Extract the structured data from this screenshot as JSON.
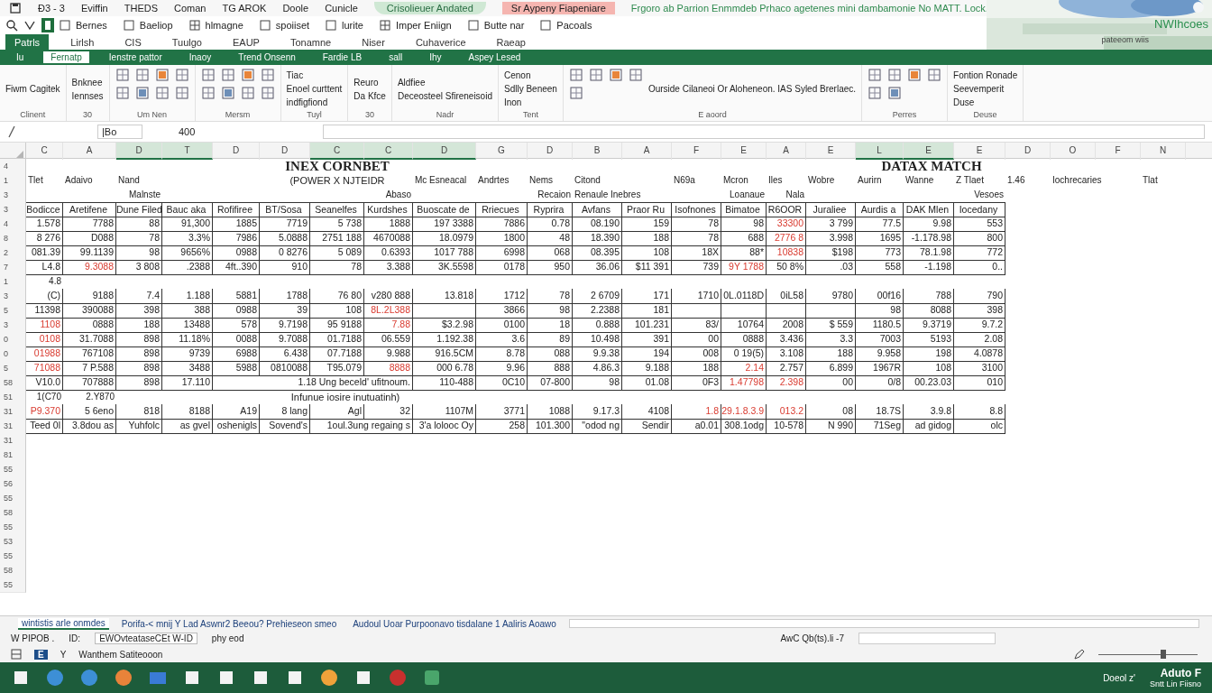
{
  "title_bar": {
    "items": [
      "Ð3 - 3",
      "Eviffin",
      "THEDS",
      "Coman",
      "TG AROK",
      "Doole",
      "Cunicle"
    ],
    "highlight": "Crisolieuer Andated",
    "alert": "Sr Aypeny Fiapeniare",
    "caption": "Frgoro ab Parrion  Enmmdeb Prhaco agetenes mini dambamonie No MATT. Lock."
  },
  "account": {
    "name": "NWIhcoes",
    "note": "pateeom wiis"
  },
  "quick_access": [
    "Bernes",
    "Baeliop",
    "hlmagne",
    "spoiiset",
    "lurite",
    "Imper Eniign",
    "Butte nar",
    "Pacoals"
  ],
  "menu_tabs": [
    {
      "label": "Patrls",
      "selected": true
    },
    {
      "label": "Lirlsh",
      "selected": false
    },
    {
      "label": "CIS",
      "selected": false
    },
    {
      "label": "Tuulgo",
      "selected": false
    },
    {
      "label": "EAUP",
      "selected": false
    },
    {
      "label": "Tonamne",
      "selected": false
    },
    {
      "label": "Niser",
      "selected": false
    },
    {
      "label": "Cuhaverice",
      "selected": false
    },
    {
      "label": "Raeap",
      "selected": false
    }
  ],
  "ribbon_tabs": [
    {
      "label": "Iu",
      "selected": false
    },
    {
      "label": "Fernatp",
      "selected": true
    },
    {
      "label": "Ienstre pattor",
      "selected": false
    },
    {
      "label": "Inaoy",
      "selected": false
    },
    {
      "label": "Trend Onsenn",
      "selected": false
    },
    {
      "label": "Fardie LB",
      "selected": false
    },
    {
      "label": "sall",
      "selected": false
    },
    {
      "label": "Ihy",
      "selected": false
    },
    {
      "label": "Aspey Lesed",
      "selected": false
    }
  ],
  "ribbon_groups": [
    {
      "name": "Clinent",
      "buttons": [
        "Fiwm Cagitek"
      ]
    },
    {
      "name": "30",
      "buttons": [
        "Bnknee",
        "Iennses"
      ]
    },
    {
      "name": "Um Nen"
    },
    {
      "name": "Mersm"
    },
    {
      "name": "Tuyl",
      "buttons": [
        "Tiac",
        "Enoel curttent",
        "indfigfiond"
      ]
    },
    {
      "name": "30",
      "buttons": [
        "Reuro",
        "Da Kfce"
      ]
    },
    {
      "name": "Nadr",
      "buttons": [
        "Aldfiee",
        "Deceosteel Sfireneisoid"
      ]
    },
    {
      "name": "Tent",
      "buttons": [
        "Cenon",
        "Sdlly Beneen",
        "Inon"
      ]
    },
    {
      "name": "E aoord",
      "buttons": [
        "Ourside Cilaneoi Or Aloheneon. IAS Syled Brerlaec."
      ]
    },
    {
      "name": "Perres"
    },
    {
      "name": "Deuse",
      "buttons": [
        "Fontion Ronade",
        "Seevemperit",
        "Duse"
      ]
    }
  ],
  "formula_bar": {
    "name_box": "|Bo",
    "value": "400"
  },
  "sheet": {
    "columns": [
      {
        "letter": "C",
        "selected": false
      },
      {
        "letter": "A",
        "selected": false
      },
      {
        "letter": "D",
        "selected": true
      },
      {
        "letter": "T",
        "selected": true
      },
      {
        "letter": "D",
        "selected": false
      },
      {
        "letter": "D",
        "selected": false
      },
      {
        "letter": "C",
        "selected": true
      },
      {
        "letter": "C",
        "selected": true
      },
      {
        "letter": "D",
        "selected": true
      },
      {
        "letter": "G",
        "selected": false
      },
      {
        "letter": "D",
        "selected": false
      },
      {
        "letter": "B",
        "selected": false
      },
      {
        "letter": "A",
        "selected": false
      },
      {
        "letter": "F",
        "selected": false
      },
      {
        "letter": "E",
        "selected": false
      },
      {
        "letter": "A",
        "selected": false
      },
      {
        "letter": "E",
        "selected": false
      },
      {
        "letter": "L",
        "selected": true
      },
      {
        "letter": "E",
        "selected": true
      },
      {
        "letter": "E",
        "selected": false
      },
      {
        "letter": "D",
        "selected": false
      },
      {
        "letter": "O",
        "selected": false
      },
      {
        "letter": "F",
        "selected": false
      },
      {
        "letter": "N",
        "selected": false
      }
    ],
    "rows": [
      {
        "num": "4",
        "kind": "labels",
        "cells": [
          null,
          null,
          null,
          null,
          null,
          {
            "text": "INEX CORNBET",
            "kind": "title"
          },
          null,
          null,
          null,
          null,
          null,
          null,
          null,
          null,
          null,
          {
            "text": "DATAX MATCH",
            "kind": "title"
          }
        ]
      },
      {
        "num": "1",
        "kind": "labels",
        "cells": [
          "Tlet",
          "Adaivo",
          "Nand",
          null,
          null,
          {
            "text": "(POWER X NJTEIDR",
            "kind": "subtitle"
          },
          "Mc Esneacal",
          "Andrtes",
          "Nems",
          "Citond",
          null,
          "N69a",
          "Mcron",
          "Iles",
          "Wobre",
          "Aurirn",
          "Wanne",
          "Z Tlaet",
          "1.46",
          {
            "text": "Iochrecaries",
            "kind": "wide"
          },
          "Tlat"
        ]
      },
      {
        "num": "3",
        "kind": "labels",
        "cells": [
          null,
          null,
          {
            "text": "Malnste",
            "kind": "right"
          },
          null,
          null,
          null,
          null,
          {
            "text": "Abaso",
            "kind": "right"
          },
          null,
          null,
          {
            "text": "Recaion",
            "kind": "right"
          },
          {
            "text": "Renaule Inebres",
            "kind": "wide"
          },
          null,
          {
            "text": "Loanaue",
            "kind": "right"
          },
          {
            "text": "Nala",
            "kind": "right"
          },
          null,
          null,
          null,
          {
            "text": "Vesoes",
            "kind": "right"
          }
        ]
      },
      {
        "num": "3",
        "kind": "header",
        "cells": [
          "Bodicce",
          "Aretifene",
          "Dune Filed",
          "Bauc aka",
          "Rofifiree",
          "BT/Sosa",
          "Seanelfes",
          "Kurdshes",
          "Buoscate de",
          "Rriecues",
          "Ryprira",
          "Avfans",
          "Praor Ru",
          "Isofnones",
          "Bimatoe",
          "R6OOR",
          "Juraliee",
          "Aurdis a",
          "DAK Mlen",
          "Iocedany"
        ]
      },
      {
        "num": "4",
        "kind": "data",
        "cells": [
          "1.578",
          "7788",
          "88",
          "91,300",
          "1885",
          "7719",
          "5 738",
          "1888",
          "197 3388",
          "7886",
          "0.78",
          "08.190",
          "159",
          "78",
          "98",
          {
            "text": "33300",
            "flagged": true
          },
          "3 799",
          "77.5",
          "9.98",
          "553"
        ]
      },
      {
        "num": "8",
        "kind": "data",
        "cells": [
          "8 276",
          "D088",
          "78",
          "3.3%",
          "7986",
          "5.0888",
          "2751 188",
          "4670088",
          "18.0979",
          "1800",
          "48",
          "18.390",
          "188",
          "78",
          "688",
          {
            "text": "2776 8",
            "flagged": true
          },
          "3.998",
          "1695",
          "-1.178.98",
          "800"
        ]
      },
      {
        "num": "2",
        "kind": "data",
        "cells": [
          "081.39",
          "99.1139",
          "98",
          "9656%",
          "0988",
          "0 8276",
          "5 089",
          "0.6393",
          "1017 788",
          "6998",
          "068",
          "08.395",
          "108",
          "18X",
          "88*",
          {
            "text": "10838",
            "flagged": true
          },
          "$198",
          "773",
          "78.1.98",
          "772"
        ]
      },
      {
        "num": "7",
        "kind": "data",
        "cells": [
          "L4.8",
          {
            "text": "9.3088",
            "flagged": true
          },
          "3 808",
          ".2388",
          "4ft..390",
          "910",
          "78",
          "3.388",
          "3K.5598",
          "0178",
          "950",
          "36.06",
          "$11 391",
          "739",
          {
            "text": "9Y 1788",
            "flagged": true
          },
          "50 8%",
          ".03",
          "558",
          "-1.198",
          "0.."
        ]
      },
      {
        "num": "1",
        "kind": "labels",
        "cells": [
          {
            "text": "4.8",
            "kind": "right"
          }
        ]
      },
      {
        "num": "3",
        "kind": "data",
        "cells": [
          "(C)",
          "9188",
          "7.4",
          "1.188",
          "5881",
          "1788",
          "76 80",
          "v280 888",
          "13.818",
          "1712",
          "78",
          "2 6709",
          "171",
          "1710",
          "0L.0118D",
          "0iL58",
          "9780",
          "00f16",
          "788",
          "790"
        ]
      },
      {
        "num": "5",
        "kind": "data",
        "cells": [
          "11398",
          "390088",
          "398",
          "388",
          "0988",
          "39",
          "108",
          {
            "text": "8L.2L388",
            "flagged": true
          },
          null,
          "3866",
          "98",
          "2.2388",
          "181",
          null,
          null,
          null,
          null,
          "98",
          "8088",
          "398"
        ]
      },
      {
        "num": "3",
        "kind": "data",
        "cells": [
          {
            "text": "1108",
            "flagged": true
          },
          "0888",
          "188",
          "13488",
          "578",
          "9.7198",
          "95 9188",
          {
            "text": "7.88",
            "flagged": true
          },
          "$3.2.98",
          "0100",
          "18",
          "0.888",
          "101.231",
          "83/",
          "10764",
          "2008",
          "$ 559",
          "1180.5",
          "9.3719",
          "9.7.2"
        ]
      },
      {
        "num": "0",
        "kind": "data",
        "cells": [
          {
            "text": "0108",
            "flagged": true
          },
          "31.7088",
          "898",
          "11.18%",
          "0088",
          "9.7088",
          "01.7188",
          "06.559",
          "1.192.38",
          "3.6",
          "89",
          "10.498",
          "391",
          "00",
          "0888",
          "3.436",
          "3.3",
          "7003",
          "5193",
          "2.08"
        ]
      },
      {
        "num": "0",
        "kind": "data",
        "cells": [
          {
            "text": "01988",
            "flagged": true
          },
          "767108",
          "898",
          "9739",
          "6988",
          "6.438",
          "07.7188",
          "9.988",
          "916.5CM",
          "8.78",
          "088",
          "9.9.38",
          "194",
          "008",
          "0 19(5)",
          "3.108",
          "188",
          "9.958",
          "198",
          "4.0878"
        ]
      },
      {
        "num": "5",
        "kind": "data",
        "cells": [
          {
            "text": "71088",
            "flagged": true
          },
          "7 P.588",
          "898",
          "3488",
          "5988",
          "0810088",
          "T95.079",
          {
            "text": "8888",
            "flagged": true
          },
          "000 6.78",
          "9.96",
          "888",
          "4.86.3",
          "9.188",
          "188",
          {
            "text": "2.14",
            "flagged": true
          },
          "2.757",
          "6.899",
          "1967R",
          "108",
          "3100"
        ]
      },
      {
        "num": "58",
        "kind": "data",
        "cells": [
          "V10.0",
          "707888",
          "898",
          "17.110",
          {
            "text": "1.18 Ung beceld' ufitnoum.",
            "kind": "merged"
          },
          "110-488",
          "0C10",
          "07-800",
          "98",
          "01.08",
          "0F3",
          {
            "text": "1.47798",
            "flagged": true
          },
          {
            "text": "2.398",
            "flagged": true
          },
          "00",
          "0/8",
          "00.23.03",
          "010"
        ]
      },
      {
        "num": "51",
        "kind": "labels",
        "cells": [
          {
            "text": "1(C70",
            "kind": "right"
          },
          {
            "text": "2.Y870",
            "kind": "right"
          },
          null,
          null,
          {
            "text": "Infunue iosire inutuatinh)",
            "kind": "note"
          }
        ]
      },
      {
        "num": "31",
        "kind": "data",
        "cells": [
          {
            "text": "P9.370",
            "flagged": true
          },
          "5 6eno",
          "818",
          "8188",
          "A19",
          "8 lang",
          "Agl",
          "32",
          "1107M",
          "3771",
          "1088",
          "9.17.3",
          "4108",
          {
            "text": "1.8",
            "flagged": true
          },
          {
            "text": "29.1.8.3.9",
            "flagged": true
          },
          {
            "text": "013.2",
            "flagged": true
          },
          "08",
          "18.7S",
          "3.9.8",
          "8.8"
        ]
      },
      {
        "num": "31",
        "kind": "data",
        "cells": [
          "Teed 0l",
          "3.8dou as",
          "Yuhfolc",
          "as gvel",
          "oshenigls",
          "Sovend's",
          {
            "text": "1oul.3ung regaing s",
            "kind": "wide"
          },
          "3'a lolooc Oy",
          "258",
          "101.300",
          "\"odod ng",
          "Sendir",
          "a0.01",
          "308.1odg",
          "10-578",
          "N 990",
          "71Seg",
          "ad gidog",
          "olc"
        ]
      },
      {
        "num": "31",
        "kind": "empty"
      },
      {
        "num": "81",
        "kind": "empty"
      },
      {
        "num": "55",
        "kind": "empty"
      },
      {
        "num": "56",
        "kind": "empty"
      },
      {
        "num": "55",
        "kind": "empty"
      },
      {
        "num": "58",
        "kind": "empty"
      },
      {
        "num": "55",
        "kind": "empty"
      },
      {
        "num": "53",
        "kind": "empty"
      },
      {
        "num": "55",
        "kind": "empty"
      },
      {
        "num": "58",
        "kind": "empty"
      },
      {
        "num": "55",
        "kind": "empty"
      }
    ]
  },
  "sheet_tabs": [
    {
      "label": "wintistis arle onmdes",
      "selected": true
    },
    {
      "label": "Porifa-< mnij Y Lad Aswnr2 Beeou? Prehieseon smeo",
      "selected": false
    },
    {
      "label": "Audoul Uoar Purpoonavo tisdalane 1 Aaliris Aoawo",
      "selected": false
    }
  ],
  "zoom": {
    "level": 0.65
  },
  "status_bar": {
    "mode": "W PIPOB .",
    "cell": "ID:",
    "info": "EWOvteataseCEt W-ID",
    "extra": "phy eod",
    "summary": "AwC Qb(ts).li -7",
    "footer": "Wanthem Satiteooon",
    "key_e": "E",
    "key_y": "Y"
  },
  "taskbar": {
    "clock_time": "Aduto F",
    "clock_date": "Sntt Lin Fiisno",
    "tray_label": "Doeol z'"
  }
}
